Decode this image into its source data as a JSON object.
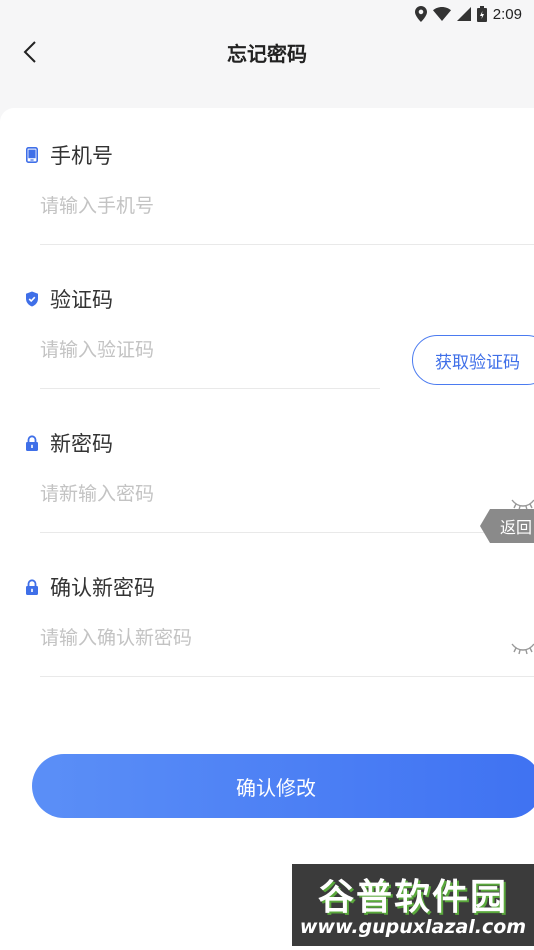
{
  "status_bar": {
    "time": "2:09"
  },
  "header": {
    "title": "忘记密码"
  },
  "form": {
    "phone": {
      "label": "手机号",
      "placeholder": "请输入手机号"
    },
    "code": {
      "label": "验证码",
      "placeholder": "请输入验证码",
      "button_label": "获取验证码"
    },
    "new_password": {
      "label": "新密码",
      "placeholder": "请新输入密码"
    },
    "confirm_password": {
      "label": "确认新密码",
      "placeholder": "请输入确认新密码"
    }
  },
  "float_back_label": "返回",
  "submit_label": "确认修改",
  "watermark": {
    "title": "谷普软件园",
    "url": "www.gupuxlazal.com"
  },
  "colors": {
    "accent": "#4b7bf0",
    "icon": "#3f6fe8",
    "background": "#f6f6f7",
    "card": "#ffffff"
  },
  "icons": {
    "phone": "phone-icon",
    "code": "shield-check-icon",
    "new_password": "lock-icon",
    "confirm_password": "lock-icon",
    "eye": "eye-closed-icon",
    "back": "chevron-left-icon"
  }
}
